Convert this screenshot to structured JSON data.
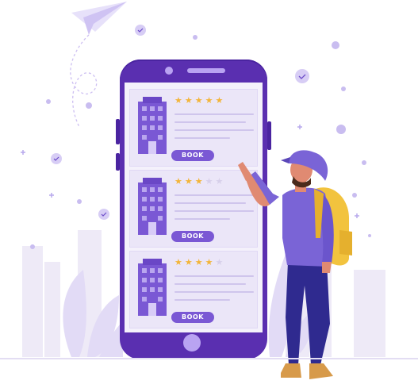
{
  "hotels": [
    {
      "book_label": "BOOK",
      "rating": 5
    },
    {
      "book_label": "BOOK",
      "rating": 3
    },
    {
      "book_label": "BOOK",
      "rating": 4
    }
  ],
  "colors": {
    "phone": "#5a2fb0",
    "accent": "#7a58d4",
    "star": "#f2b53a",
    "backpack": "#f2c33e"
  }
}
